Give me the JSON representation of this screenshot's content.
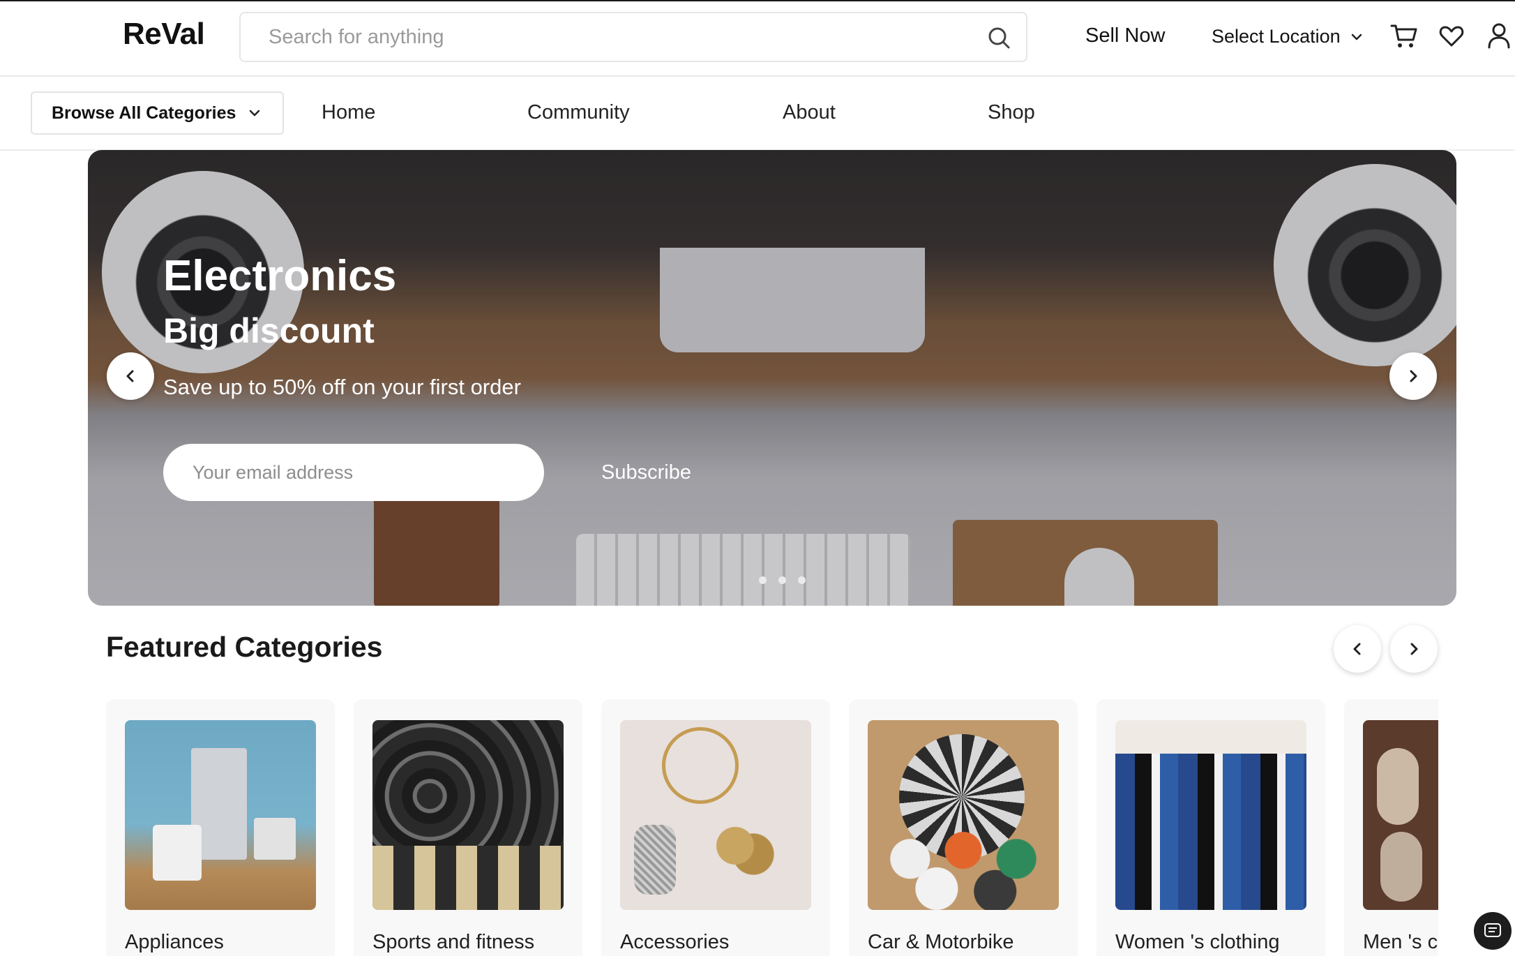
{
  "header": {
    "logo": "ReVal",
    "search_placeholder": "Search for anything",
    "sell_now": "Sell Now",
    "location_label": "Select Location",
    "icons": [
      "search-icon",
      "cart-icon",
      "heart-icon",
      "user-icon"
    ]
  },
  "nav": {
    "browse_label": "Browse All Categories",
    "links": [
      "Home",
      "Community",
      "About",
      "Shop"
    ]
  },
  "hero": {
    "title": "Electronics",
    "subtitle": "Big discount",
    "text": "Save up to 50% off on your first order",
    "email_placeholder": "Your email address",
    "subscribe_label": "Subscribe",
    "slide_count": 3
  },
  "featured": {
    "title": "Featured Categories",
    "categories": [
      "Appliances",
      "Sports and fitness",
      "Accessories",
      "Car & Motorbike",
      "Women 's clothing",
      "Men 's c"
    ]
  },
  "colors": {
    "text": "#1f1f1f",
    "border": "#e6e6e6",
    "card_bg": "#f8f8f8"
  }
}
